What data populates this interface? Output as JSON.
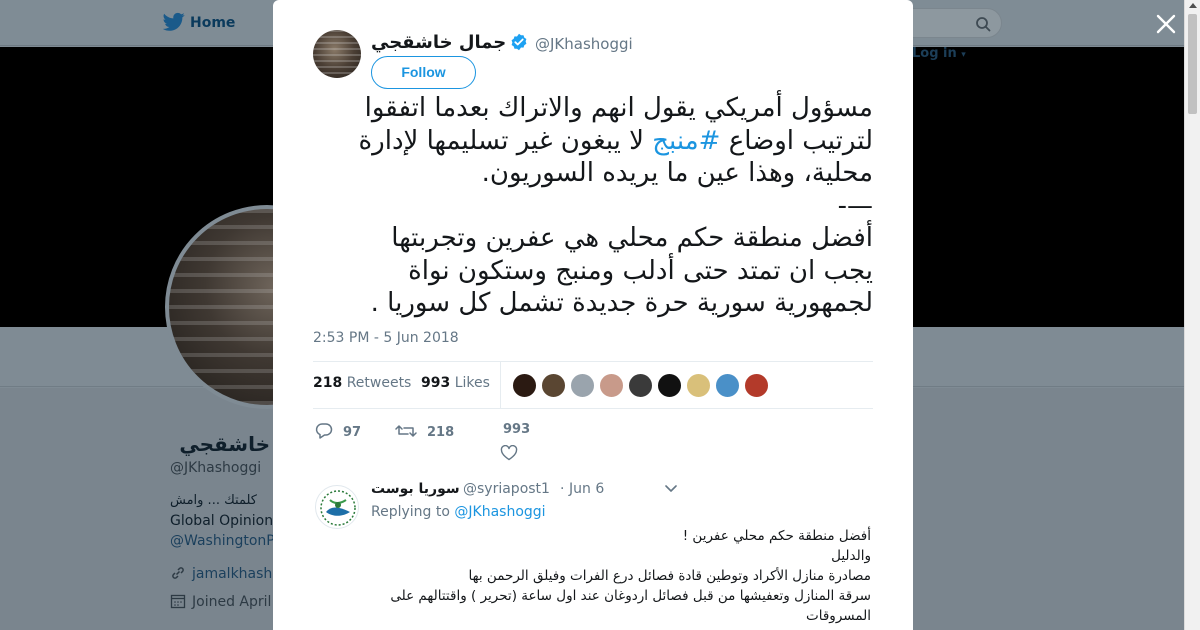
{
  "page": {
    "nav_home": "Home",
    "login": "Log in",
    "profile": {
      "name": "خاشقجي",
      "handle": "@JKhashoggi",
      "bio_line1": "كلمتك ... وامش",
      "bio_line2": "Global Opinion",
      "bio_line3": "@WashingtonP",
      "link": "jamalkhash",
      "joined": "Joined April"
    }
  },
  "modal": {
    "author": {
      "name": "جمال خاشقجي",
      "handle": "@JKhashoggi",
      "verified": true
    },
    "follow_label": "Follow",
    "tweet": {
      "line1": "مسؤول أمريكي يقول انهم والاتراك بعدما اتفقوا",
      "line2_pre": "لترتيب اوضاع ",
      "hashtag": "#منبج",
      "line2_post": " لا يبغون غير تسليمها لإدارة",
      "line3": "محلية، وهذا عين ما يريده السوريون.",
      "line4": "—-",
      "line5": "أفضل منطقة حكم محلي هي عفرين وتجربتها",
      "line6": "يجب ان تمتد حتى أدلب ومنبج وستكون نواة",
      "line7": "لجمهورية سورية حرة جديدة تشمل كل سوريا ."
    },
    "timestamp": "2:53 PM - 5 Jun 2018",
    "stats": {
      "retweets_count": "218",
      "retweets_label": "Retweets",
      "likes_count": "993",
      "likes_label": "Likes"
    },
    "likers_colors": [
      "#2b1a12",
      "#5a4632",
      "#9aa4ad",
      "#c89a8a",
      "#3a3a3a",
      "#111111",
      "#d9c07a",
      "#4a90c8",
      "#b33a2a"
    ],
    "actions": {
      "replies": "97",
      "retweets": "218",
      "likes": "993"
    },
    "reply": {
      "name": "سوريا بوست",
      "handle": "@syriapost1",
      "dot": "·",
      "date": "Jun 6",
      "replying_prefix": "Replying to",
      "replying_to": "@JKhashoggi",
      "line1": "أفضل منطقة حكم محلي عفرين !",
      "line2": "والدليل",
      "line3": "مصادرة منازل الأكراد وتوطين قادة فصائل درع الفرات وفيلق الرحمن بها",
      "line4": "سرقة المنازل وتعفيشها من قبل فصائل اردوغان عند اول ساعة (تحرير ) واقتتالهم على",
      "line5": "المسروقات"
    }
  }
}
